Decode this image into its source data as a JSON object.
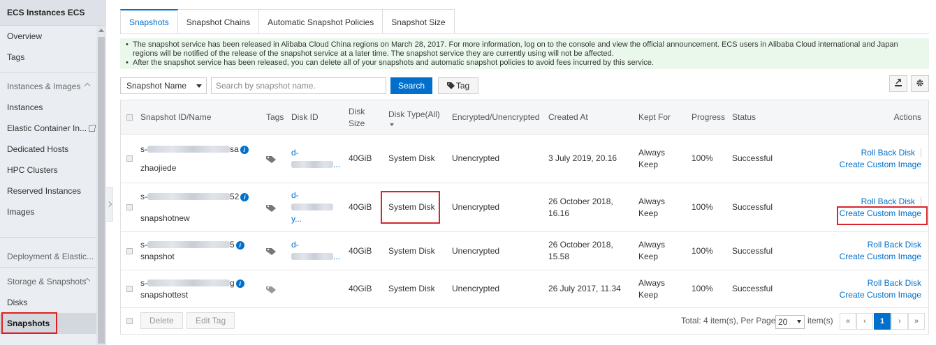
{
  "sidebar": {
    "title": "ECS Instances ECS",
    "items": [
      {
        "label": "Overview"
      },
      {
        "label": "Tags"
      },
      {
        "label": "Instances & Images"
      },
      {
        "label": "Instances"
      },
      {
        "label": "Elastic Container In..."
      },
      {
        "label": "Dedicated Hosts"
      },
      {
        "label": "HPC Clusters"
      },
      {
        "label": "Reserved Instances"
      },
      {
        "label": "Images"
      },
      {
        "label": "Deployment & Elastic..."
      },
      {
        "label": "Storage & Snapshots"
      },
      {
        "label": "Disks"
      },
      {
        "label": "Snapshots"
      }
    ]
  },
  "tabs": [
    "Snapshots",
    "Snapshot Chains",
    "Automatic Snapshot Policies",
    "Snapshot Size"
  ],
  "notice": {
    "line1": "The snapshot service has been released in Alibaba Cloud China regions on March 28, 2017. For more information, log on to the console and view the official announcement. ECS users in Alibaba Cloud international and Japan regions will be notified of the release of the snapshot service at a later time. The snapshot service they are currently using will not be affected.",
    "line2": "After the snapshot service has been released, you can delete all of your snapshots and automatic snapshot policies to avoid fees incurred by this service."
  },
  "toolbar": {
    "filter_select": "Snapshot Name",
    "search_placeholder": "Search by snapshot name.",
    "search_label": "Search",
    "tag_label": "Tag"
  },
  "table": {
    "headers": {
      "id_name": "Snapshot ID/Name",
      "tags": "Tags",
      "disk_id": "Disk ID",
      "disk_size": "Disk Size",
      "disk_type": "Disk Type(All)",
      "encrypted": "Encrypted/Unencrypted",
      "created_at": "Created At",
      "kept_for": "Kept For",
      "progress": "Progress",
      "status": "Status",
      "actions": "Actions"
    },
    "rows": [
      {
        "id_prefix": "s-",
        "id_suffix": "sa",
        "name": "zhaojiede",
        "disk_prefix": "d-",
        "disk_suffix": "...",
        "size": "40GiB",
        "type": "System Disk",
        "encrypted": "Unencrypted",
        "created": "3 July 2019, 20.16",
        "kept": "Always Keep",
        "progress": "100%",
        "status": "Successful",
        "action1": "Roll Back Disk",
        "action2": "Create Custom Image"
      },
      {
        "id_prefix": "s-",
        "id_suffix": "52",
        "name": "snapshotnew",
        "disk_prefix": "d-",
        "disk_suffix": "y...",
        "size": "40GiB",
        "type": "System Disk",
        "encrypted": "Unencrypted",
        "created": "26 October 2018, 16.16",
        "kept": "Always Keep",
        "progress": "100%",
        "status": "Successful",
        "action1": "Roll Back Disk",
        "action2": "Create Custom Image"
      },
      {
        "id_prefix": "s-",
        "id_suffix": "5",
        "name": "snapshot",
        "disk_prefix": "d-",
        "disk_suffix": "...",
        "size": "40GiB",
        "type": "System Disk",
        "encrypted": "Unencrypted",
        "created": "26 October 2018, 15.58",
        "kept": "Always Keep",
        "progress": "100%",
        "status": "Successful",
        "action1": "Roll Back Disk",
        "action2": "Create Custom Image"
      },
      {
        "id_prefix": "s-",
        "id_suffix": "g",
        "name": "snapshottest",
        "disk_prefix": "",
        "disk_suffix": "",
        "size": "40GiB",
        "type": "System Disk",
        "encrypted": "Unencrypted",
        "created": "26 July 2017, 11.34",
        "kept": "Always Keep",
        "progress": "100%",
        "status": "Successful",
        "action1": "Roll Back Disk",
        "action2": "Create Custom Image"
      }
    ]
  },
  "footer": {
    "delete_label": "Delete",
    "edit_tag_label": "Edit Tag",
    "total_text": "Total: 4 item(s), Per Page:",
    "per_page": "20",
    "items_text": "item(s)",
    "first": "«",
    "prev": "‹",
    "current_page": "1",
    "next": "›",
    "last": "»"
  },
  "colors": {
    "accent": "#0070cc",
    "highlight": "#d7262b",
    "notice_bg": "#eaf8ec"
  }
}
